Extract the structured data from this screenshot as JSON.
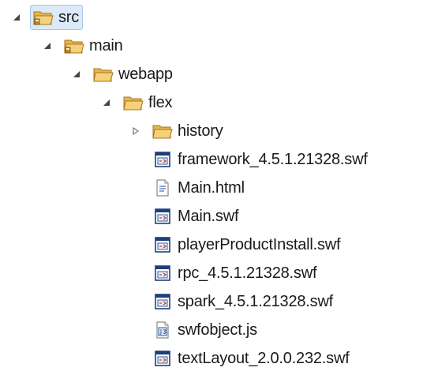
{
  "tree": {
    "items": [
      {
        "label": "src",
        "icon": "package-folder-icon",
        "state": "expanded",
        "selected": true
      },
      {
        "label": "main",
        "icon": "package-folder-icon",
        "state": "expanded"
      },
      {
        "label": "webapp",
        "icon": "folder-open-icon",
        "state": "expanded"
      },
      {
        "label": "flex",
        "icon": "folder-open-icon",
        "state": "expanded"
      },
      {
        "label": "history",
        "icon": "folder-open-icon",
        "state": "collapsed"
      },
      {
        "label": "framework_4.5.1.21328.swf",
        "icon": "swf-file-icon"
      },
      {
        "label": "Main.html",
        "icon": "html-file-icon"
      },
      {
        "label": "Main.swf",
        "icon": "swf-file-icon"
      },
      {
        "label": "playerProductInstall.swf",
        "icon": "swf-file-icon"
      },
      {
        "label": "rpc_4.5.1.21328.swf",
        "icon": "swf-file-icon"
      },
      {
        "label": "spark_4.5.1.21328.swf",
        "icon": "swf-file-icon"
      },
      {
        "label": "swfobject.js",
        "icon": "js-file-icon"
      },
      {
        "label": "textLayout_2.0.0.232.swf",
        "icon": "swf-file-icon"
      }
    ]
  },
  "colors": {
    "selection_bg": "#dbe9f8",
    "selection_border": "#a6c5e8",
    "folder": "#f2c96a",
    "swf_frame": "#1f3f7a",
    "text": "#1a1a1a"
  }
}
